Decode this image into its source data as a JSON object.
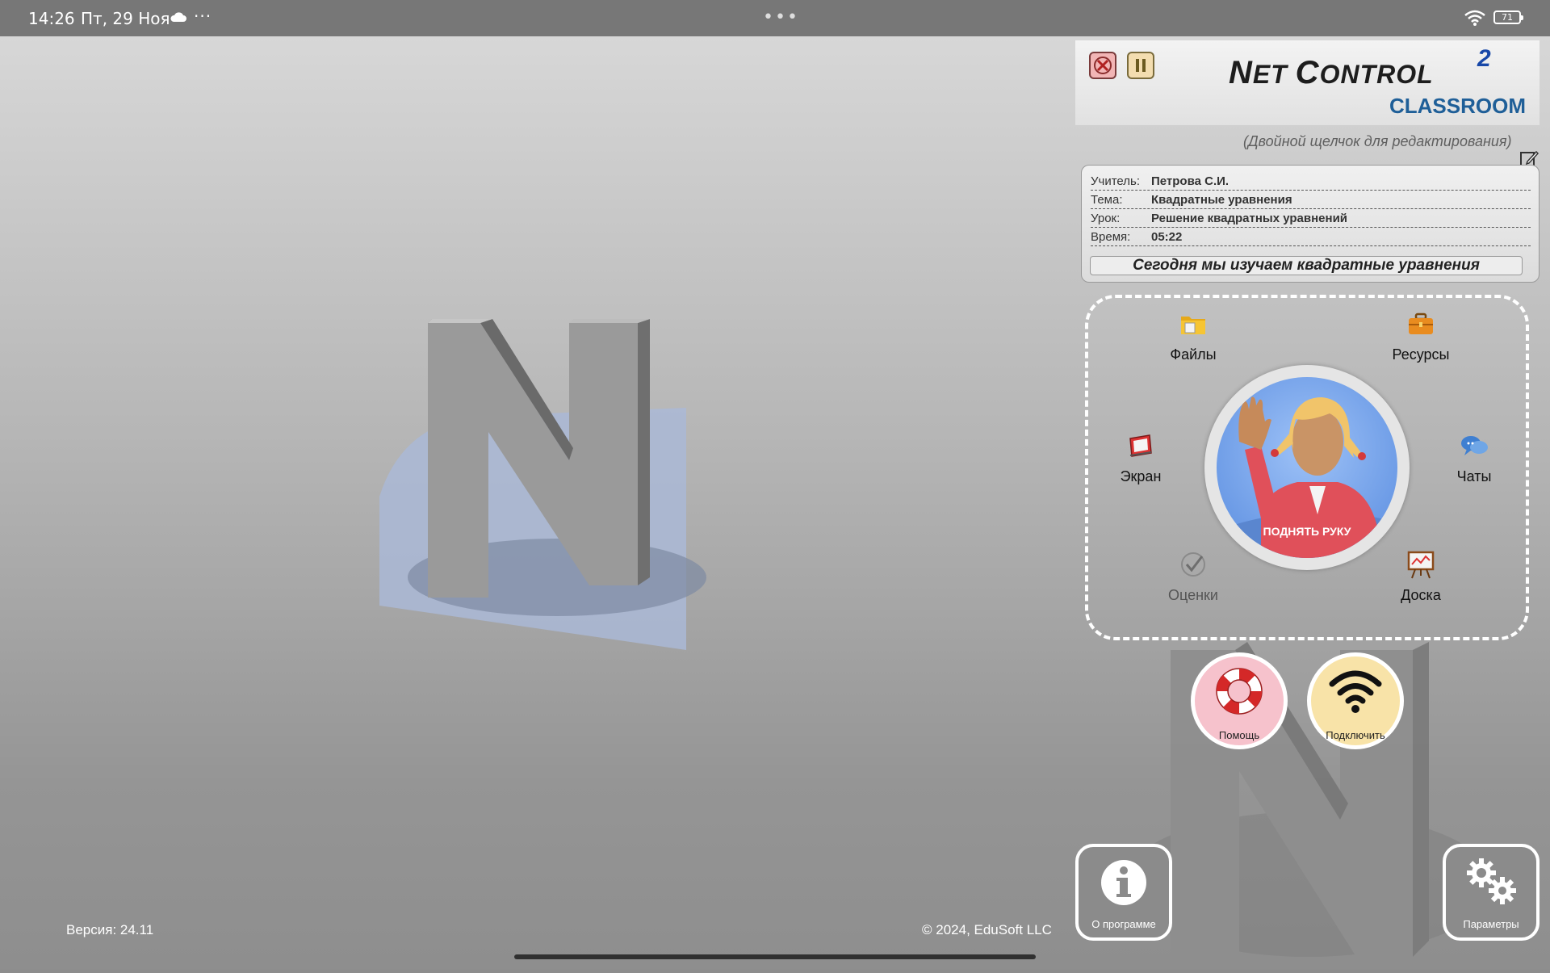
{
  "status_bar": {
    "time": "14:26",
    "date": "Пт, 29 Ноя",
    "more": "···",
    "center": "•••",
    "battery": "71"
  },
  "brand": {
    "title_first": "N",
    "title_first_rest": "ET ",
    "title_second": "C",
    "title_second_rest": "ONTROL",
    "superscript": "2",
    "subtitle": "CLASSROOM"
  },
  "edit_hint": "(Двойной щелчок для редактирования)",
  "info": {
    "rows": [
      {
        "label": "Учитель:",
        "value": "Петрова С.И."
      },
      {
        "label": "Тема:",
        "value": "Квадратные уравнения"
      },
      {
        "label": "Урок:",
        "value": "Решение квадратных уравнений"
      },
      {
        "label": "Время:",
        "value": "05:22"
      }
    ],
    "message": "Сегодня мы изучаем квадратные уравнения"
  },
  "actions": {
    "files": "Файлы",
    "resources": "Ресурсы",
    "screen": "Экран",
    "chats": "Чаты",
    "grades": "Оценки",
    "board": "Доска",
    "raise_hand": "ПОДНЯТЬ РУКУ"
  },
  "buttons": {
    "help": "Помощь",
    "connect": "Подключить",
    "about": "О программе",
    "settings": "Параметры"
  },
  "footer": {
    "version": "Версия: 24.11",
    "copyright": "© 2024, EduSoft LLC"
  },
  "colors": {
    "brand_blue": "#1f5f98",
    "help_bg": "#f6c2cc",
    "connect_bg": "#f8e3a8"
  }
}
